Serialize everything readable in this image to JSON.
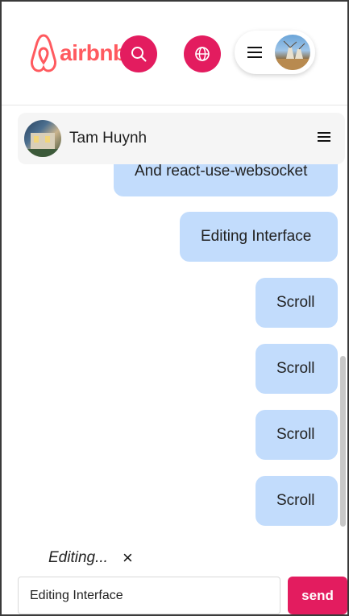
{
  "header": {
    "logo_text": "airbnb",
    "brand_color": "#ff5a5f",
    "accent_color": "#e31c5f",
    "search_icon": "search-icon",
    "globe_icon": "globe-icon",
    "menu_icon": "hamburger-icon"
  },
  "chat": {
    "contact_name": "Tam Huynh",
    "menu_icon": "hamburger-icon"
  },
  "messages": [
    {
      "text": "And react-use-websocket"
    },
    {
      "text": "Editing Interface"
    },
    {
      "text": "Scroll"
    },
    {
      "text": "Scroll"
    },
    {
      "text": "Scroll"
    },
    {
      "text": "Scroll"
    }
  ],
  "composer": {
    "editing_label": "Editing...",
    "cancel_glyph": "×",
    "input_value": "Editing Interface",
    "send_label": "send"
  }
}
